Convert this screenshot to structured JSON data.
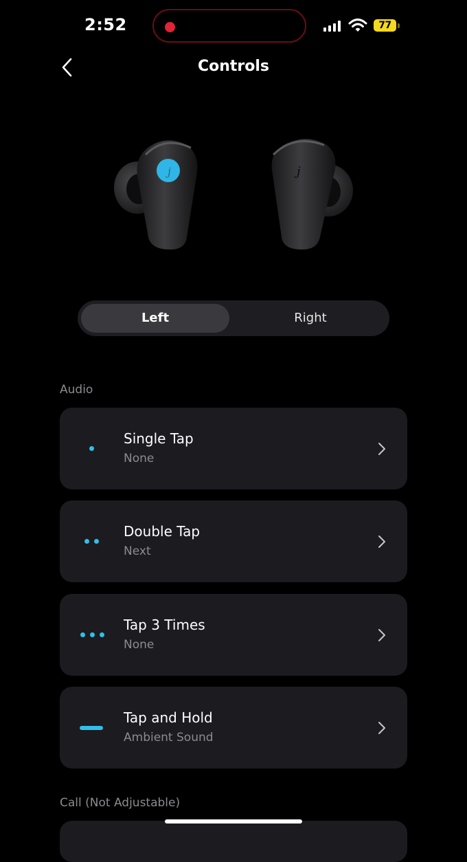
{
  "status_bar": {
    "time": "2:52",
    "battery": "77"
  },
  "header": {
    "title": "Controls"
  },
  "selector": {
    "left_label": "Left",
    "right_label": "Right",
    "selected": "Left"
  },
  "audio": {
    "section_label": "Audio",
    "items": [
      {
        "label": "Single Tap",
        "value": "None",
        "icon": "single-dot-icon"
      },
      {
        "label": "Double Tap",
        "value": "Next",
        "icon": "double-dot-icon"
      },
      {
        "label": "Tap 3 Times",
        "value": "None",
        "icon": "triple-dot-icon"
      },
      {
        "label": "Tap and Hold",
        "value": "Ambient Sound",
        "icon": "hold-bar-icon"
      }
    ]
  },
  "call": {
    "section_label": "Call (Not Adjustable)"
  },
  "colors": {
    "accent": "#2fc0ea",
    "card": "#1c1b20",
    "record": "#e02436",
    "battery": "#f5d820"
  }
}
